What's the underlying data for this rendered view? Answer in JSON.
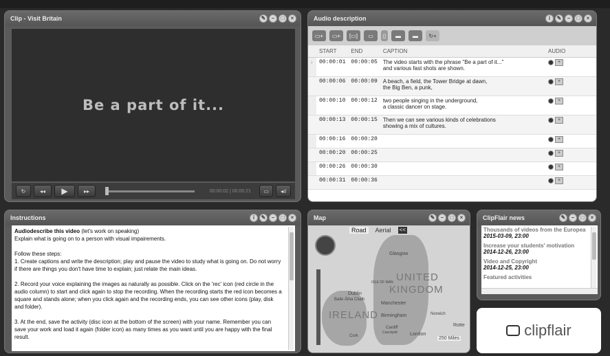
{
  "video_panel": {
    "title": "Clip - Visit Britain",
    "screen_text": "Be a part of it...",
    "time_current": "00:00:02",
    "time_total": "00:00:21",
    "controls": [
      "loop-icon",
      "rewind-icon",
      "play-icon",
      "fast-forward-icon"
    ]
  },
  "audio_panel": {
    "title": "Audio description",
    "columns": {
      "start": "START",
      "end": "END",
      "caption": "CAPTION",
      "audio": "AUDIO"
    },
    "rows": [
      {
        "start": "00:00:01",
        "end": "00:00:05",
        "caption1": "The video starts with the phrase \"Be a part of it...\"",
        "caption2": "and various fast shots are shown."
      },
      {
        "start": "00:00:06",
        "end": "00:00:09",
        "caption1": "A beach, a field, the Tower Bridge at dawn,",
        "caption2": "the Big Ben, a punk,"
      },
      {
        "start": "00:00:10",
        "end": "00:00:12",
        "caption1": "two people singing in the underground,",
        "caption2": "a classic dancer on stage."
      },
      {
        "start": "00:00:13",
        "end": "00:00:15",
        "caption1": "Then we can see various kinds of celebrations",
        "caption2": "showing a mix of cultures."
      },
      {
        "start": "00:00:16",
        "end": "00:00:20",
        "caption1": "",
        "caption2": ""
      },
      {
        "start": "00:00:20",
        "end": "00:00:25",
        "caption1": "",
        "caption2": ""
      },
      {
        "start": "00:00:26",
        "end": "00:00:30",
        "caption1": "",
        "caption2": ""
      },
      {
        "start": "00:00:31",
        "end": "00:00:36",
        "caption1": "",
        "caption2": ""
      }
    ]
  },
  "instructions_panel": {
    "title": "Instructions",
    "heading_bold": "Audiodescribe this video",
    "heading_rest": " (let's work on speaking)",
    "line1": "Explain what is going on to a person with visual impairements.",
    "steps_intro": "Follow these steps:",
    "step1": "1. Create captions and write the description; play and pause the video to study what is going on.  Do not worry if there are things you don't have time to explain; just relate the main ideas.",
    "step2": "2. Record your voice explaining the images as naturally as possible. Click on the 'rec' icon (red circle in the audio column) to start and click again to stop the recording. When the recording starts the red icon becomes a square and stands alone; when you click again and the recording ends, you can see other icons (play, disk and folder).",
    "step3": "3. At the end, save the activity (disc icon at the bottom of the screen) with your name. Remember you can save your work and load it again (folder icon) as many times as you want until you are happy with the final result."
  },
  "map_panel": {
    "title": "Map",
    "tab_road": "Road",
    "tab_aerial": "Aerial",
    "collapse": "<<",
    "labels": {
      "glasgow": "Glasgow",
      "united": "UNITED",
      "kingdom": "KINGDOM",
      "isle_of_man": "ISLE OF MAN",
      "dublin": "Dublin",
      "baile": "Baile Átha Cliath",
      "manchester": "Manchester",
      "ireland": "IRELAND",
      "birmingham": "Birmingham",
      "norwich": "Norwich",
      "cardiff": "Cardiff",
      "caerdydd": "Caerdydd",
      "cork": "Cork",
      "london": "London",
      "rotterdam": "Rotte",
      "scale": "250 Miles"
    }
  },
  "news_panel": {
    "title": "ClipFlair news",
    "items": [
      {
        "title": "Thousands of videos from the Europea",
        "date": "2015-03-09, 23:00"
      },
      {
        "title": "Increase your students' motivation",
        "date": "2014-12-26, 23:00"
      },
      {
        "title": "Video and Copyright",
        "date": "2014-12-25, 23:00"
      },
      {
        "title": "Featured activities",
        "date": ""
      }
    ]
  },
  "logo": {
    "text": "clipflair"
  }
}
